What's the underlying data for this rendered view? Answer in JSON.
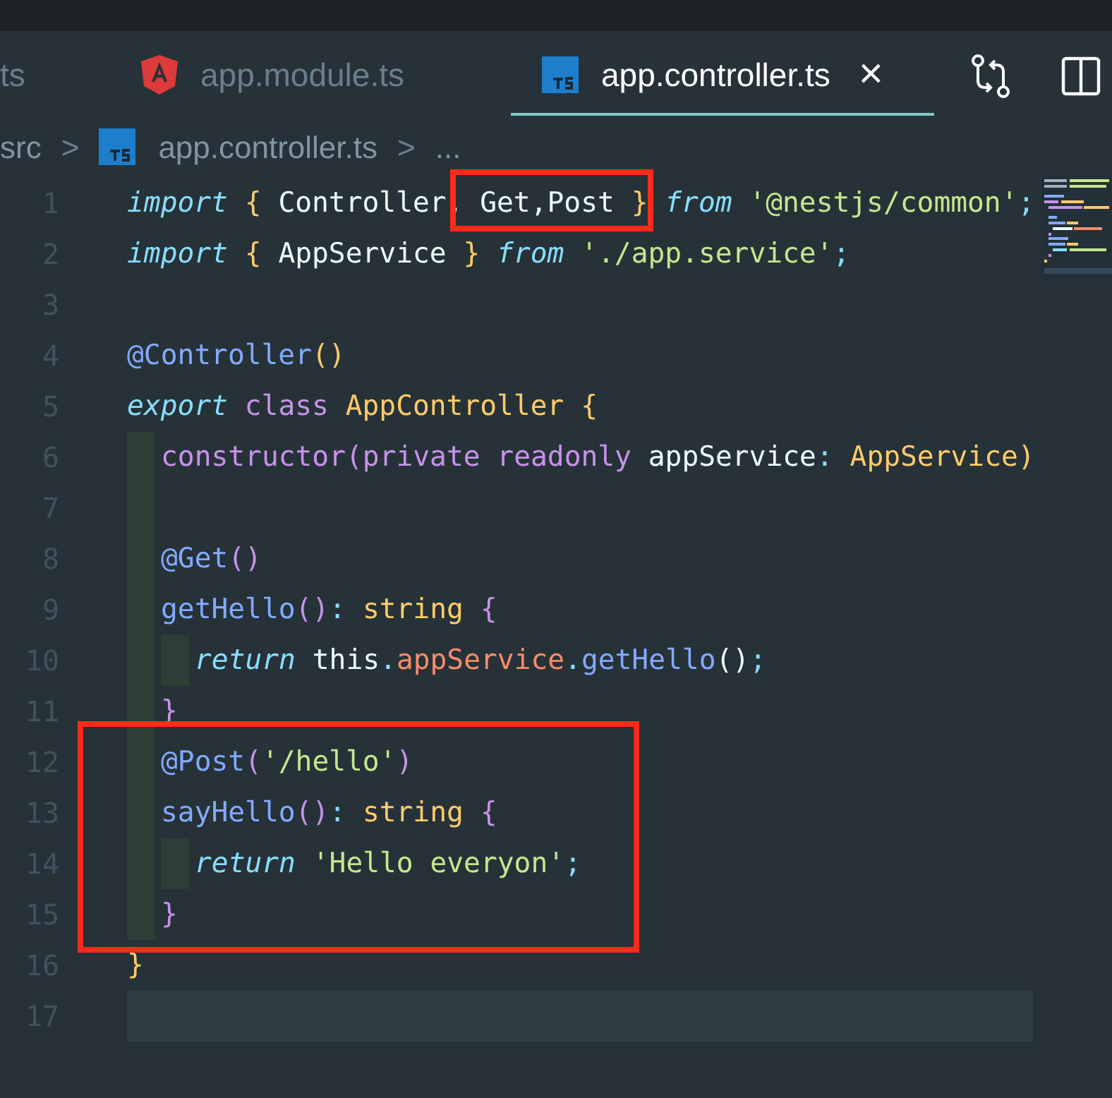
{
  "tabs": [
    {
      "label": "ts",
      "selected": false
    },
    {
      "label": "app.module.ts",
      "selected": false
    },
    {
      "label": "app.controller.ts",
      "selected": true,
      "close": "×"
    }
  ],
  "breadcrumb": [
    {
      "label": "src"
    },
    {
      "label": "app.controller.ts"
    },
    {
      "label": "..."
    }
  ],
  "breadcrumb_separator": ">",
  "code_lines": [
    {
      "number": "1",
      "current": false,
      "tokens": [
        {
          "t": "import ",
          "kind": "keyword"
        },
        {
          "t": "{",
          "kind": "brace"
        },
        {
          "t": " Controller, Get,Post ",
          "kind": "name"
        },
        {
          "t": "}",
          "kind": "brace"
        },
        {
          "t": " from",
          "kind": "keyword"
        },
        {
          "t": " '@nestjs/common'",
          "kind": "string"
        },
        {
          "t": ";",
          "kind": "operator"
        }
      ]
    },
    {
      "number": "2",
      "current": false,
      "tokens": [
        {
          "t": "import ",
          "kind": "keyword"
        },
        {
          "t": "{",
          "kind": "brace"
        },
        {
          "t": " AppService ",
          "kind": "name"
        },
        {
          "t": "}",
          "kind": "brace"
        },
        {
          "t": " from",
          "kind": "keyword"
        },
        {
          "t": " './app.service'",
          "kind": "string"
        },
        {
          "t": ";",
          "kind": "operator"
        }
      ]
    },
    {
      "number": "3",
      "current": false
    },
    {
      "number": "4",
      "current": false,
      "tokens": [
        {
          "t": "@Controller",
          "kind": "function"
        },
        {
          "t": "()",
          "kind": "brace"
        }
      ]
    },
    {
      "number": "5",
      "current": false,
      "tokens": [
        {
          "t": "export ",
          "kind": "keyword"
        },
        {
          "t": "class ",
          "kind": "storage"
        },
        {
          "t": "AppController ",
          "kind": "type"
        },
        {
          "t": "{",
          "kind": "brace"
        }
      ],
      "children": [
        {
          "number": "6",
          "current": false,
          "tokens": [
            {
              "t": "constructor(private readonly ",
              "kind": "storage"
            },
            {
              "t": "appService",
              "kind": "name"
            },
            {
              "t": ": ",
              "kind": "operator"
            },
            {
              "t": "AppService)",
              "kind": "type"
            }
          ]
        },
        {
          "number": "7",
          "current": false
        },
        {
          "number": "8",
          "current": false,
          "tokens": [
            {
              "t": "@Get",
              "kind": "function"
            },
            {
              "t": "()",
              "kind": "paren"
            }
          ]
        },
        {
          "number": "9",
          "current": false,
          "tokens": [
            {
              "t": "getHello",
              "kind": "function"
            },
            {
              "t": "()",
              "kind": "paren"
            },
            {
              "t": ": ",
              "kind": "operator"
            },
            {
              "t": "string ",
              "kind": "type"
            },
            {
              "t": "{",
              "kind": "paren"
            }
          ],
          "children": [
            {
              "number": "10",
              "current": false,
              "tokens": [
                {
                  "t": "return",
                  "kind": "keyword"
                },
                {
                  "t": " this",
                  "kind": "name"
                },
                {
                  "t": ".",
                  "kind": "operator"
                },
                {
                  "t": "appService",
                  "kind": "property"
                },
                {
                  "t": ".",
                  "kind": "operator"
                },
                {
                  "t": "getHello",
                  "kind": "function"
                },
                {
                  "t": "()",
                  "kind": "name"
                },
                {
                  "t": ";",
                  "kind": "operator"
                }
              ]
            }
          ]
        },
        {
          "number": "11",
          "current": false,
          "tokens": [
            {
              "t": "}",
              "kind": "paren"
            }
          ]
        },
        {
          "number": "12",
          "current": false,
          "tokens": [
            {
              "t": "@Post",
              "kind": "function"
            },
            {
              "t": "(",
              "kind": "paren"
            },
            {
              "t": "'/hello'",
              "kind": "string"
            },
            {
              "t": ")",
              "kind": "paren"
            }
          ]
        },
        {
          "number": "13",
          "current": false,
          "tokens": [
            {
              "t": "sayHello",
              "kind": "function"
            },
            {
              "t": "()",
              "kind": "paren"
            },
            {
              "t": ": ",
              "kind": "operator"
            },
            {
              "t": "string ",
              "kind": "type"
            },
            {
              "t": "{",
              "kind": "paren"
            }
          ],
          "children": [
            {
              "number": "14",
              "current": false,
              "tokens": [
                {
                  "t": "return ",
                  "kind": "keyword"
                },
                {
                  "t": "'Hello everyon'",
                  "kind": "string"
                },
                {
                  "t": ";",
                  "kind": "operator"
                }
              ]
            }
          ]
        },
        {
          "number": "15",
          "current": false,
          "tokens": [
            {
              "t": "}",
              "kind": "paren"
            }
          ]
        }
      ]
    },
    {
      "number": "16",
      "current": false,
      "tokens": [
        {
          "t": "}",
          "kind": "brace"
        }
      ]
    },
    {
      "number": "17",
      "current": true
    }
  ],
  "annotation_boxes": [
    {
      "color": "#ff2a17"
    },
    {
      "color": "#ff2a17"
    }
  ]
}
